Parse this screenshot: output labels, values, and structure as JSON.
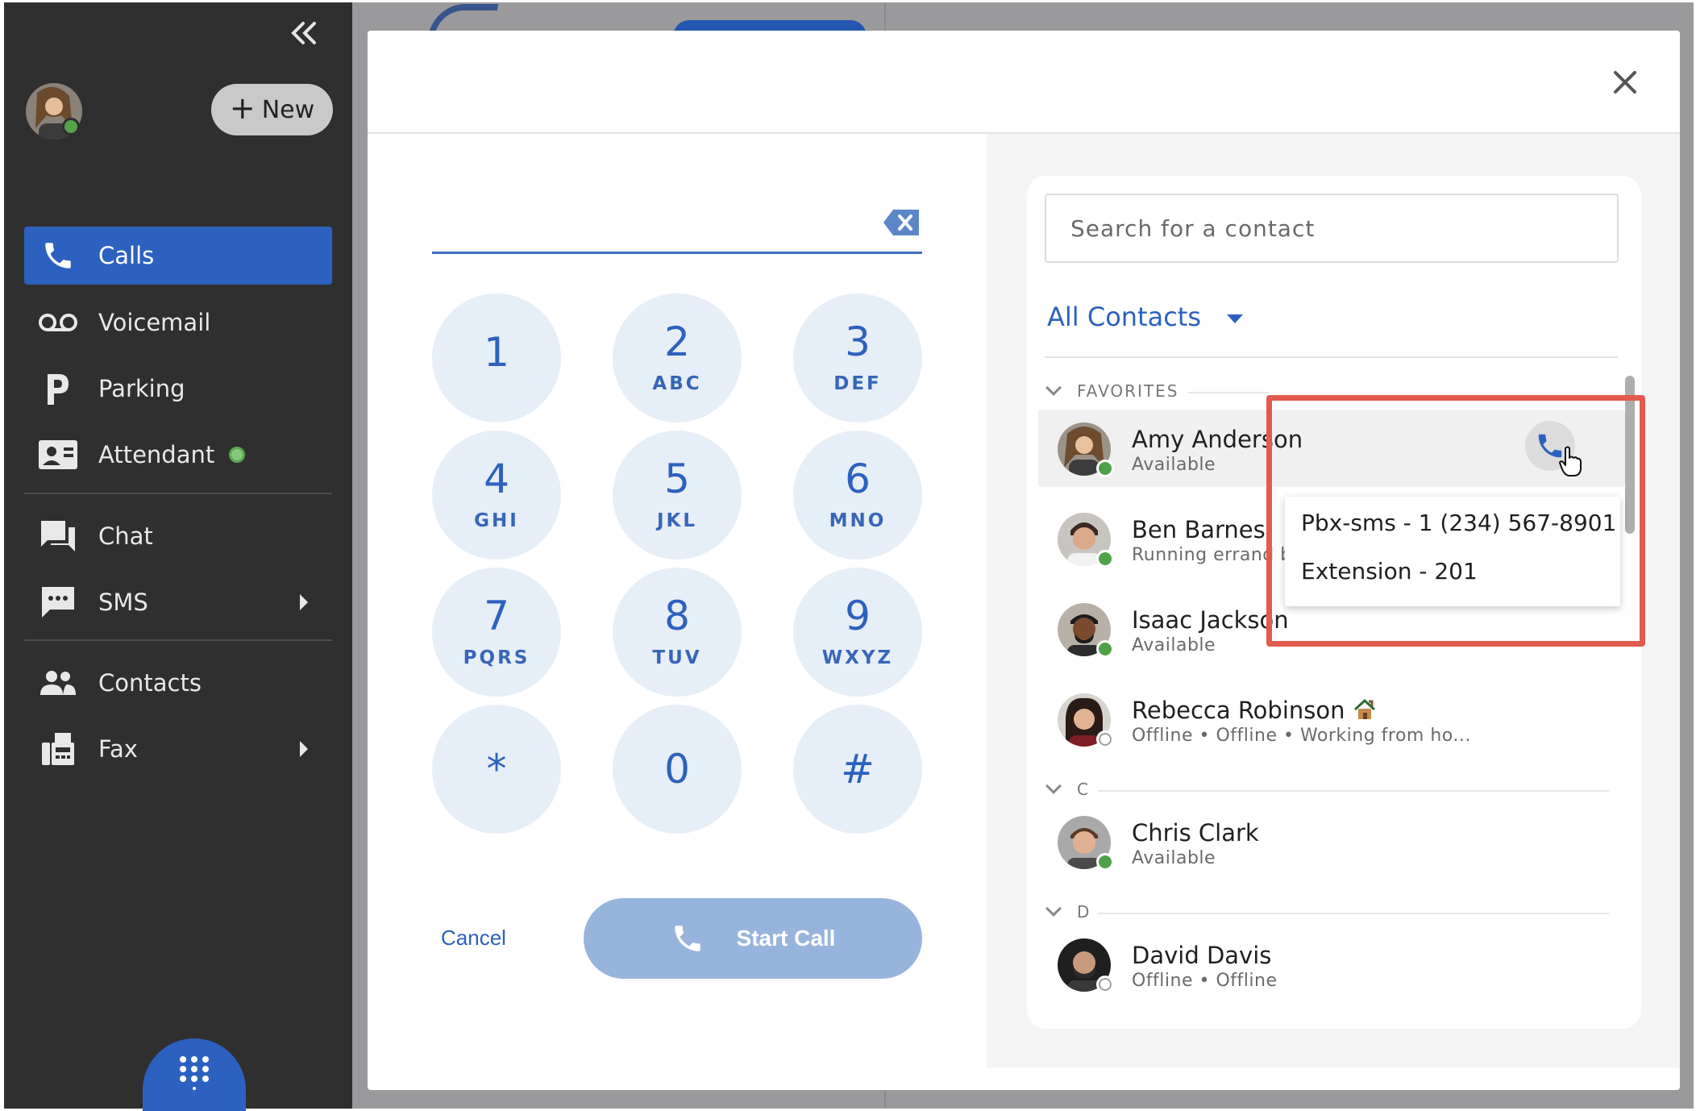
{
  "sidebar": {
    "new_button": "New",
    "nav": [
      {
        "label": "Calls",
        "icon": "phone-icon",
        "active": true
      },
      {
        "label": "Voicemail",
        "icon": "voicemail-icon"
      },
      {
        "label": "Parking",
        "icon": "parking-icon"
      },
      {
        "label": "Attendant",
        "icon": "attendant-icon"
      },
      {
        "label": "Chat",
        "icon": "chat-icon"
      },
      {
        "label": "SMS",
        "icon": "sms-icon"
      },
      {
        "label": "Contacts",
        "icon": "contacts-icon"
      },
      {
        "label": "Fax",
        "icon": "fax-icon"
      }
    ]
  },
  "dialer": {
    "keys": [
      {
        "digit": "1",
        "letters": ""
      },
      {
        "digit": "2",
        "letters": "ABC"
      },
      {
        "digit": "3",
        "letters": "DEF"
      },
      {
        "digit": "4",
        "letters": "GHI"
      },
      {
        "digit": "5",
        "letters": "JKL"
      },
      {
        "digit": "6",
        "letters": "MNO"
      },
      {
        "digit": "7",
        "letters": "PQRS"
      },
      {
        "digit": "8",
        "letters": "TUV"
      },
      {
        "digit": "9",
        "letters": "WXYZ"
      },
      {
        "digit": "*",
        "letters": ""
      },
      {
        "digit": "0",
        "letters": ""
      },
      {
        "digit": "#",
        "letters": ""
      }
    ],
    "cancel_label": "Cancel",
    "start_call_label": "Start Call"
  },
  "contacts": {
    "search_placeholder": "Search for a contact",
    "filter_label": "All Contacts",
    "groups": {
      "favorites": "FAVORITES",
      "c": "C",
      "d": "D"
    },
    "list": [
      {
        "name": "Amy Anderson",
        "status": "Available",
        "presence": "online"
      },
      {
        "name": "Ben Barnes",
        "status": "Running errand b",
        "presence": "online"
      },
      {
        "name": "Isaac Jackson",
        "status": "Available",
        "presence": "online"
      },
      {
        "name": "Rebecca Robinson",
        "status": "Offline • Offline • Working from ho...",
        "presence": "offline"
      },
      {
        "name": "Chris Clark",
        "status": "Available",
        "presence": "online"
      },
      {
        "name": "David Davis",
        "status": "Offline • Offline",
        "presence": "offline"
      }
    ],
    "call_menu": [
      "Pbx-sms - 1 (234) 567-8901",
      "Extension - 201"
    ]
  },
  "colors": {
    "accent": "#2c61bf",
    "sidebar_bg": "#2f2f30",
    "key_bg": "#e6eef7",
    "start_call_bg": "#97b4dc",
    "online": "#4ea146",
    "highlight": "#e15b4f"
  }
}
